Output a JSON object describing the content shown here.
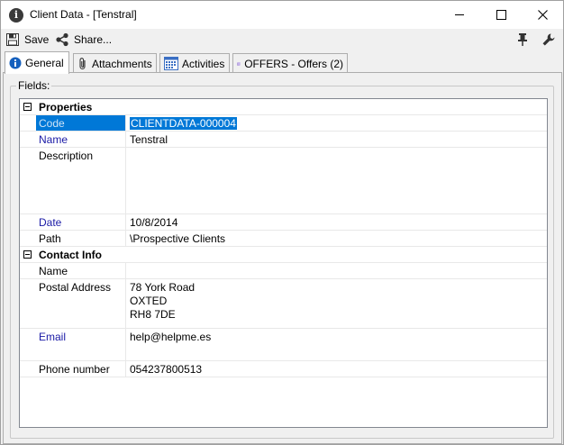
{
  "window": {
    "title": "Client Data - [Tenstral]"
  },
  "toolbar": {
    "save_label": "Save",
    "share_label": "Share..."
  },
  "tabs": [
    {
      "label": "General",
      "active": true
    },
    {
      "label": "Attachments",
      "active": false
    },
    {
      "label": "Activities",
      "active": false
    },
    {
      "label": "OFFERS - Offers (2)",
      "active": false
    }
  ],
  "fields": {
    "legend": "Fields:",
    "categories": {
      "properties": "Properties",
      "contact_info": "Contact Info"
    },
    "rows": {
      "code": {
        "label": "Code",
        "value": "CLIENTDATA-000004"
      },
      "name": {
        "label": "Name",
        "value": "Tenstral"
      },
      "description": {
        "label": "Description",
        "value": ""
      },
      "date": {
        "label": "Date",
        "value": "10/8/2014"
      },
      "path": {
        "label": "Path",
        "value": "\\Prospective Clients"
      },
      "contact_name": {
        "label": "Name",
        "value": ""
      },
      "postal_address": {
        "label": "Postal Address",
        "value": "78 York Road\nOXTED\nRH8 7DE"
      },
      "email": {
        "label": "Email",
        "value": "help@helpme.es"
      },
      "phone": {
        "label": "Phone number",
        "value": "054237800513"
      }
    }
  },
  "colors": {
    "selection": "#0078d7",
    "link_label": "#1a1aa6"
  }
}
